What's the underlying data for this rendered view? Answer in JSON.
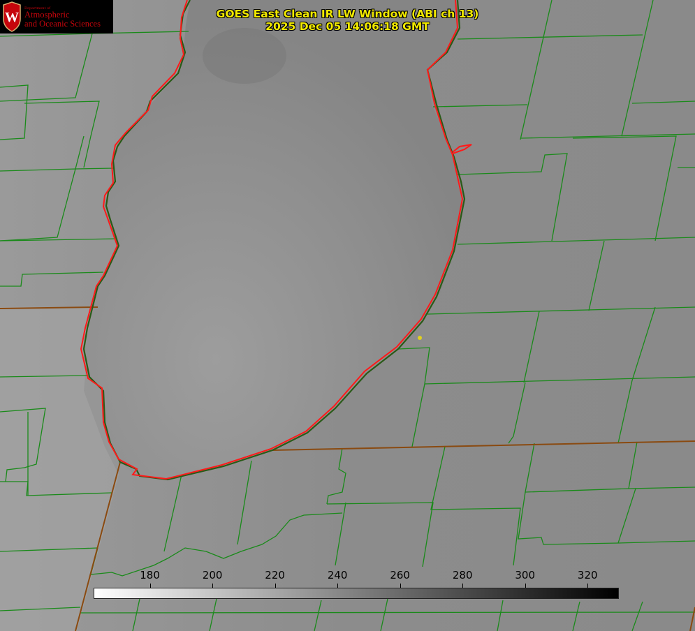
{
  "logo": {
    "department": "Department of",
    "line1": "Atmospheric",
    "line2": "and Oceanic Sciences"
  },
  "title": {
    "line1": "GOES East Clean IR LW Window (ABI ch 13)",
    "line2": "2025 Dec 05 14:06:18 GMT"
  },
  "colorbar": {
    "ticks": [
      "180",
      "200",
      "220",
      "240",
      "260",
      "280",
      "300",
      "320"
    ],
    "range": [
      162,
      330
    ],
    "gradient": "white-to-black"
  },
  "colors": {
    "title": "#f2ea00",
    "county_border": "#1a8a1a",
    "state_border": "#8a4a10",
    "coastline": "#ff1a1a",
    "marker": "#e0d020",
    "logo_text": "#c5050c"
  }
}
